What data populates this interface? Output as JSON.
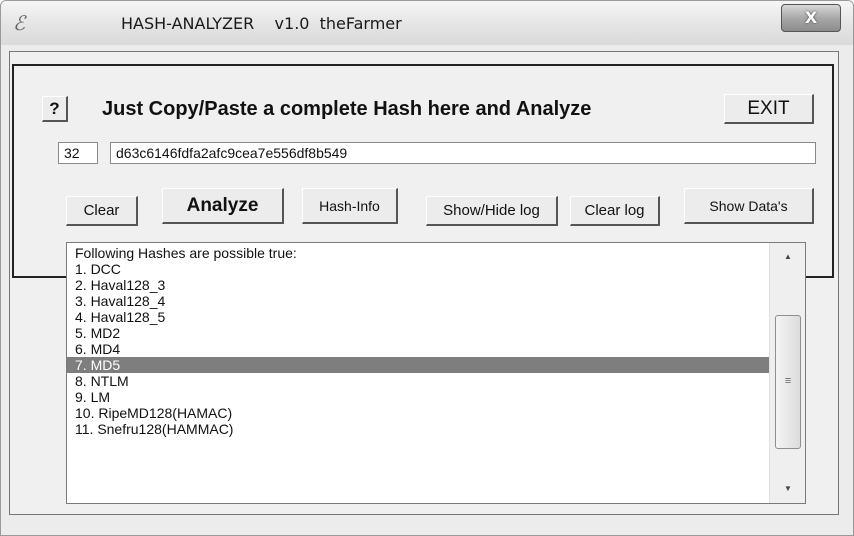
{
  "window": {
    "app_icon": "ℰ",
    "title": "HASH-ANALYZER    v1.0  theFarmer",
    "close_label": "X"
  },
  "toolbar": {
    "help_label": "?",
    "heading": "Just Copy/Paste a complete Hash here and Analyze",
    "exit_label": "EXIT"
  },
  "hash": {
    "length": "32",
    "value": "d63c6146fdfa2afc9cea7e556df8b549"
  },
  "buttons": {
    "clear": "Clear",
    "analyze": "Analyze",
    "hash_info": "Hash-Info",
    "show_hide_log": "Show/Hide log",
    "clear_log": "Clear log",
    "show_data": "Show Data's"
  },
  "log": {
    "lines": [
      "Following Hashes are possible true:",
      "1. DCC",
      "2. Haval128_3",
      "3. Haval128_4",
      "4. Haval128_5",
      "5. MD2",
      "6. MD4",
      "7. MD5",
      "8. NTLM",
      "9. LM",
      "10. RipeMD128(HAMAC)",
      "11. Snefru128(HAMMAC)"
    ],
    "selected_index": 7
  },
  "scrollbar": {
    "up_icon": "▲",
    "down_icon": "▼",
    "grip_icon": "≡"
  }
}
